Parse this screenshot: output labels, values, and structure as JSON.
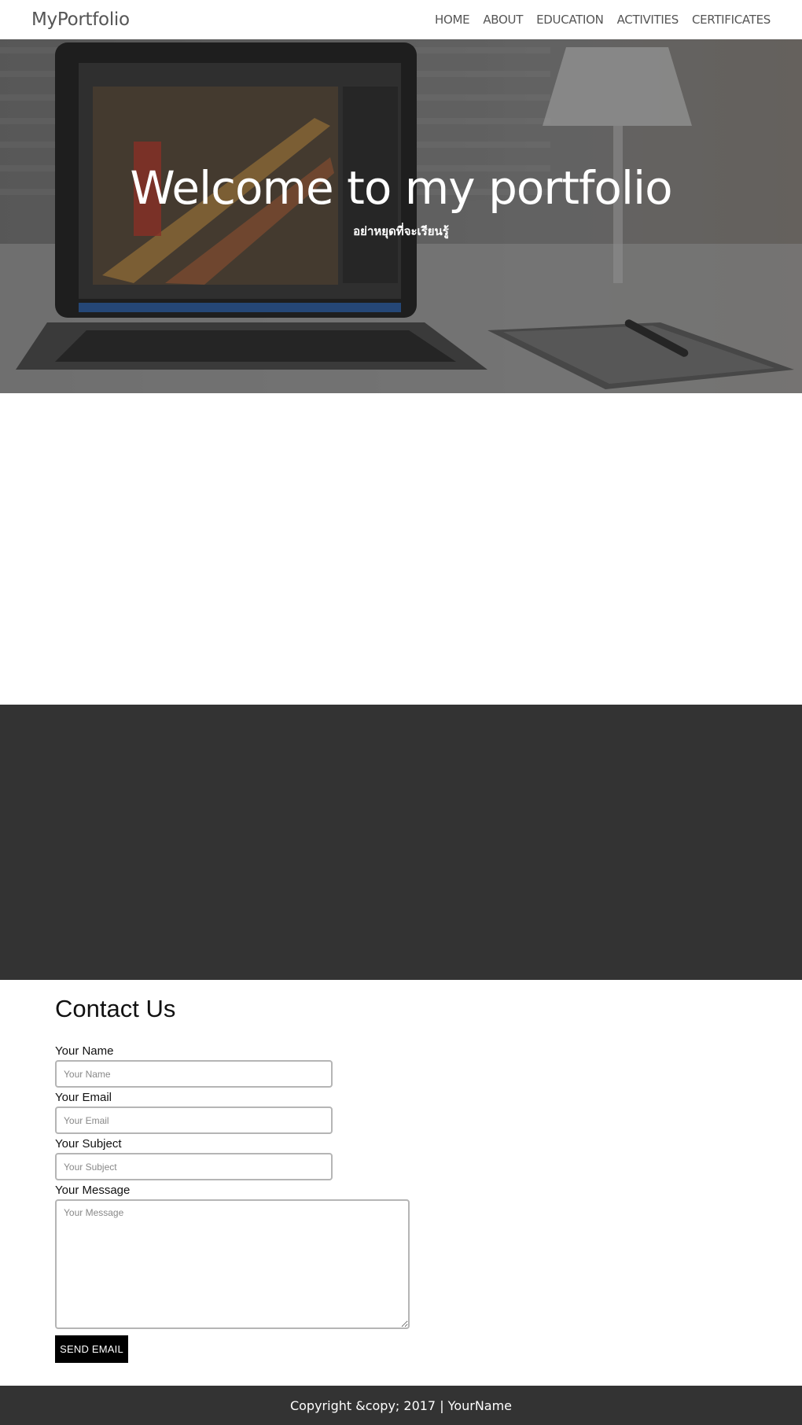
{
  "navbar": {
    "brand": "MyPortfolio",
    "links": [
      "HOME",
      "ABOUT",
      "EDUCATION",
      "ACTIVITIES",
      "CERTIFICATES"
    ]
  },
  "hero": {
    "title": "Welcome to my portfolio",
    "subtitle": "อย่าหยุดที่จะเรียนรู้"
  },
  "contact": {
    "title": "Contact Us",
    "fields": {
      "name": {
        "label": "Your Name",
        "placeholder": "Your Name"
      },
      "email": {
        "label": "Your Email",
        "placeholder": "Your Email"
      },
      "subject": {
        "label": "Your Subject",
        "placeholder": "Your Subject"
      },
      "message": {
        "label": "Your Message",
        "placeholder": "Your Message"
      }
    },
    "submit_label": "SEND EMAIL"
  },
  "footer": {
    "text": "Copyright &copy; 2017 | YourName"
  },
  "colors": {
    "dark_section": "#333333",
    "footer_bg": "#333333",
    "button_bg": "#000000"
  }
}
